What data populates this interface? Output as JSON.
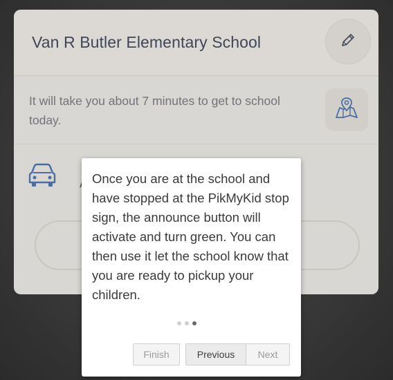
{
  "card": {
    "school_name": "Van R Butler Elementary School",
    "eta_text": "It will take you about 7 minutes to get to school today.",
    "car_partial_text": "A"
  },
  "popup": {
    "message": "Once you are at the school and have stopped at the PikMyKid stop sign, the announce button will activate and turn green. You can then use it let the school know that you are ready to pickup your children.",
    "finish_label": "Finish",
    "previous_label": "Previous",
    "next_label": "Next",
    "page_dots": 3,
    "active_dot": 3
  },
  "icons": {
    "edit": "pencil-icon",
    "map": "map-pin-icon",
    "car": "car-icon"
  },
  "colors": {
    "title": "#3e4657",
    "icon_blue": "#3a5a8c",
    "overlay": "#3d3d3d"
  }
}
